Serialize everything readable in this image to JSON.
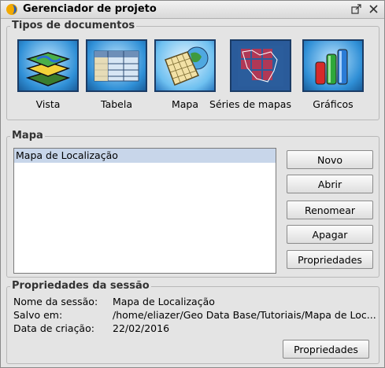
{
  "window": {
    "title": "Gerenciador de projeto"
  },
  "doc_types": {
    "legend": "Tipos de documentos",
    "items": [
      {
        "label": "Vista",
        "icon": "layers-map-icon"
      },
      {
        "label": "Tabela",
        "icon": "table-icon"
      },
      {
        "label": "Mapa",
        "icon": "map-icon"
      },
      {
        "label": "Séries de mapas",
        "icon": "map-series-icon"
      },
      {
        "label": "Gráficos",
        "icon": "bar-chart-icon"
      }
    ]
  },
  "maps": {
    "legend": "Mapa",
    "list": [
      "Mapa de Localização"
    ],
    "buttons": {
      "new": "Novo",
      "open": "Abrir",
      "rename": "Renomear",
      "delete": "Apagar",
      "properties": "Propriedades"
    }
  },
  "session": {
    "legend": "Propriedades da sessão",
    "name_label": "Nome da sessão:",
    "name_value": "Mapa de Localização",
    "saved_label": "Salvo em:",
    "saved_value": "/home/eliazer/Geo Data Base/Tutoriais/Mapa de Loc...",
    "date_label": "Data de criação:",
    "date_value": "22/02/2016",
    "properties_button": "Propriedades"
  }
}
